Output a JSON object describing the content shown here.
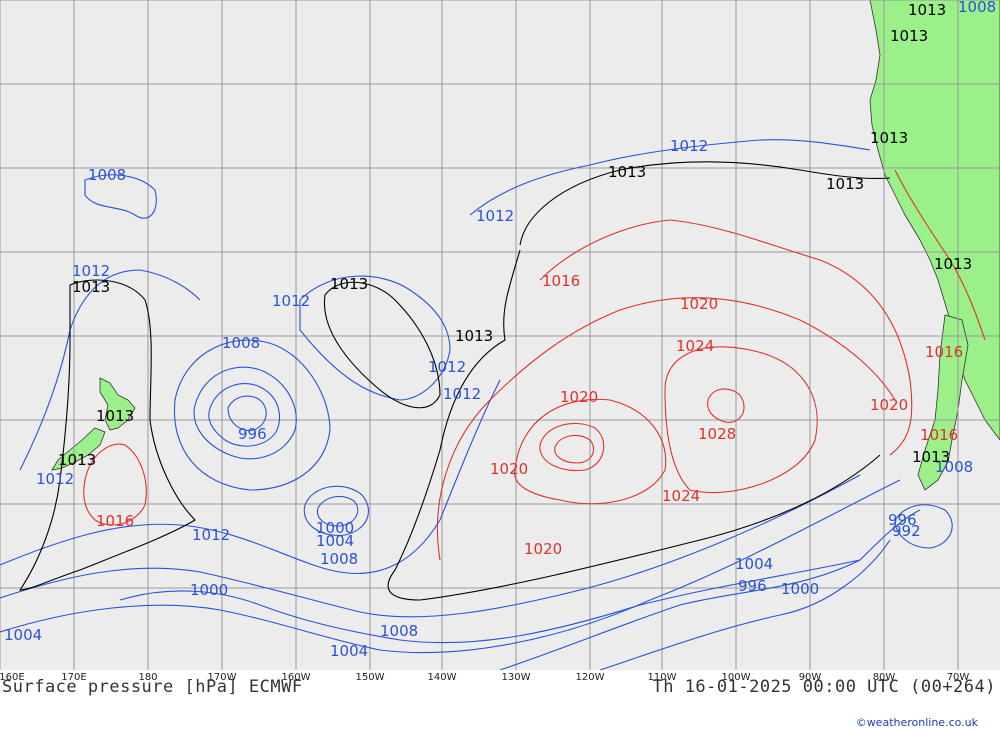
{
  "map": {
    "title": "Surface pressure [hPa] ECMWF",
    "valid_time": "Th 16-01-2025 00:00 UTC (00+264)",
    "credit": "©weatheronline.co.uk",
    "colors": {
      "ocean": "#ececec",
      "land": "#9cf08a",
      "grid": "#9a9a9a",
      "low_isobar": "#2a52d6",
      "reference_isobar": "#000000",
      "high_isobar": "#e0322a",
      "coast": "#333333"
    },
    "longitude_labels": [
      "160E",
      "170E",
      "180",
      "170W",
      "160W",
      "150W",
      "140W",
      "130W",
      "120W",
      "110W",
      "100W",
      "90W",
      "80W",
      "70W"
    ],
    "isobar_labels": {
      "blue": [
        "1008",
        "1012",
        "1012",
        "1012",
        "1012",
        "1012",
        "1012",
        "1012",
        "1008",
        "996",
        "1000",
        "1004",
        "1008",
        "1012",
        "1000",
        "1004",
        "1008",
        "1004",
        "1004",
        "996",
        "1000",
        "996",
        "992",
        "1008",
        "1008"
      ],
      "black": [
        "1013",
        "1013",
        "1013",
        "1013",
        "1013",
        "1013",
        "1013",
        "1013",
        "1013",
        "1013",
        "1013",
        "1013"
      ],
      "red": [
        "1016",
        "1020",
        "1024",
        "1020",
        "1028",
        "1020",
        "1024",
        "1020",
        "1020",
        "1016",
        "1016",
        "1016"
      ]
    }
  }
}
